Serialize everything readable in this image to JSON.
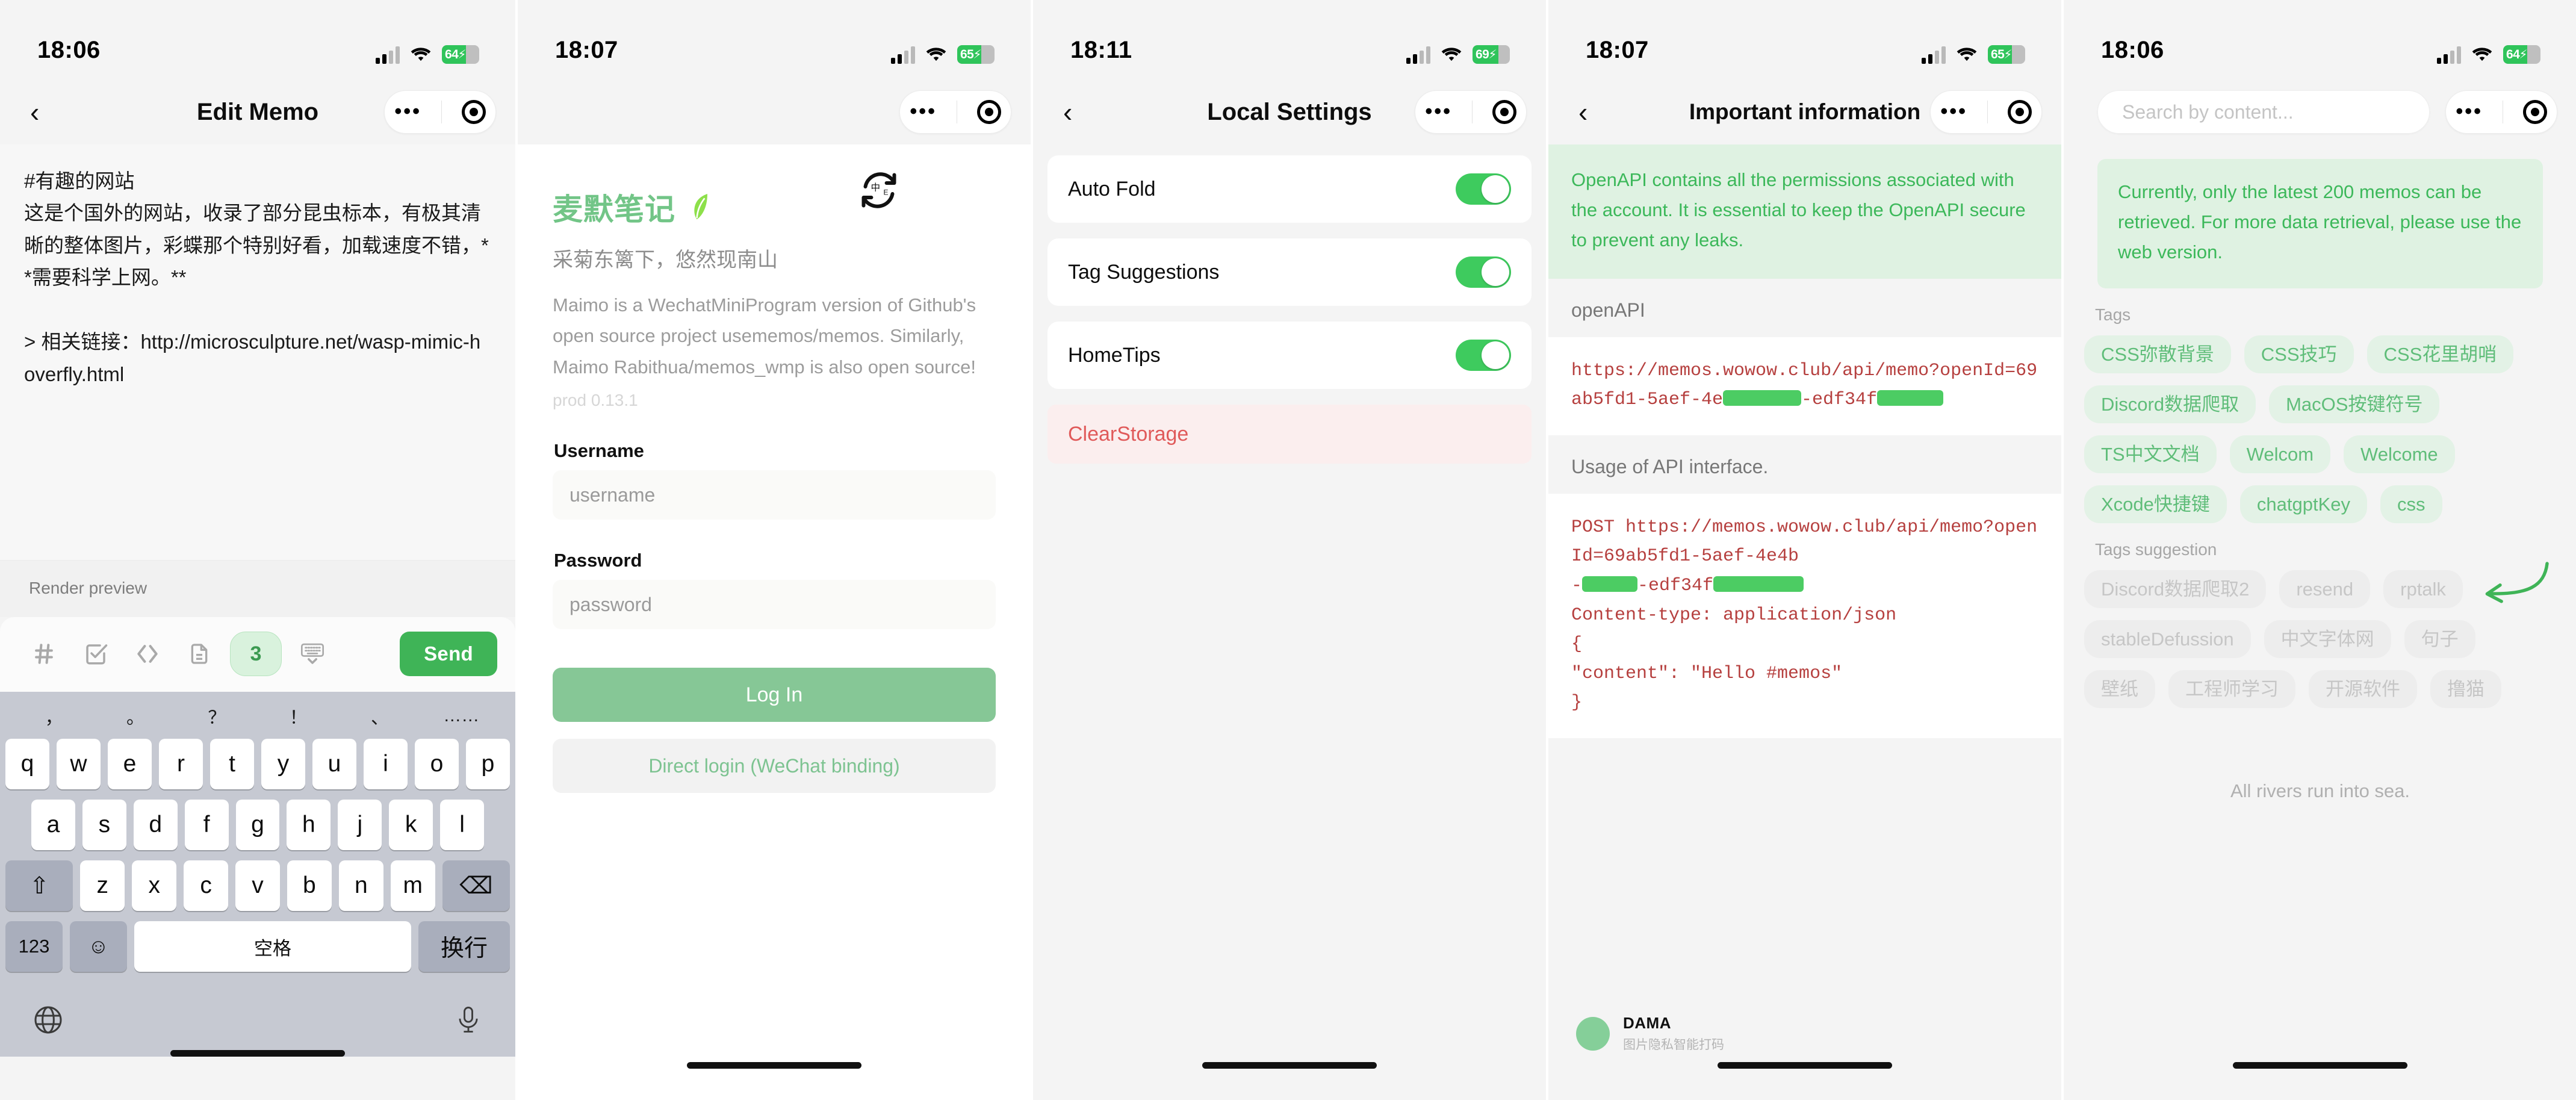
{
  "panels": {
    "memo_editor": {
      "status": {
        "time": "18:06",
        "battery": "64",
        "battery_pct_num": 64
      },
      "nav": {
        "back": "‹",
        "title": "Edit Memo",
        "more": "•••"
      },
      "memo_text": "#有趣的网站\n这是个国外的网站，收录了部分昆虫标本，有极其清晰的整体图片，彩蝶那个特别好看，加载速度不错，**需要科学上网。**\n\n> 相关链接：http://microsculpture.net/wasp-mimic-hoverfly.html",
      "render_preview_label": "Render preview",
      "toolbar": {
        "hash_icon": "hash-icon",
        "todo_icon": "checkbox-icon",
        "code_icon": "code-icon",
        "file_icon": "file-icon",
        "count": "3",
        "keyboard_icon": "keyboard-collapse-icon",
        "send_label": "Send"
      },
      "keyboard": {
        "suggestions": [
          "，",
          "。",
          "？",
          "！",
          "、",
          "……"
        ],
        "row1": [
          "q",
          "w",
          "e",
          "r",
          "t",
          "y",
          "u",
          "i",
          "o",
          "p"
        ],
        "row2": [
          "a",
          "s",
          "d",
          "f",
          "g",
          "h",
          "j",
          "k",
          "l"
        ],
        "row3_shift": "⇧",
        "row3": [
          "z",
          "x",
          "c",
          "v",
          "b",
          "n",
          "m"
        ],
        "row3_backspace": "⌫",
        "row4_num": "123",
        "row4_emoji": "☺",
        "row4_space": "空格",
        "row4_return": "换行",
        "globe_icon": "globe-icon",
        "mic_icon": "microphone-icon"
      }
    },
    "login": {
      "status": {
        "time": "18:07",
        "battery": "65",
        "battery_pct_num": 65
      },
      "nav": {
        "lang_toggle": "中/E",
        "more": "•••"
      },
      "brand_title": "麦默笔记",
      "brand_icon": "leaf-pen-icon",
      "tagline": "采菊东篱下，悠然现南山",
      "description": "Maimo is a WechatMiniProgram version of Github's open source project usememos/memos. Similarly, Maimo Rabithua/memos_wmp is also open source!",
      "version": "prod 0.13.1",
      "username_label": "Username",
      "username_placeholder": "username",
      "password_label": "Password",
      "password_placeholder": "password",
      "login_button": "Log In",
      "wechat_button": "Direct login (WeChat binding)"
    },
    "local_settings": {
      "status": {
        "time": "18:11",
        "battery": "69",
        "battery_pct_num": 69
      },
      "nav": {
        "back": "‹",
        "title": "Local Settings",
        "more": "•••"
      },
      "rows": [
        {
          "label": "Auto Fold",
          "toggle": "on"
        },
        {
          "label": "Tag Suggestions",
          "toggle": "on"
        },
        {
          "label": "HomeTips",
          "toggle": "on"
        }
      ],
      "clear_storage": "ClearStorage"
    },
    "important_info": {
      "status": {
        "time": "18:07",
        "battery": "65",
        "battery_pct_num": 65
      },
      "nav": {
        "back": "‹",
        "title": "Important information",
        "more": "•••"
      },
      "notice": "OpenAPI contains all the permissions associated with the account. It is essential to keep the OpenAPI secure to prevent any leaks.",
      "section1_label": "openAPI",
      "code1_prefix": "https://memos.wowow.club/api/memo?openId=69ab5fd1-5aef-4e",
      "code1_mid": "-edf34f",
      "section2_label": "Usage of API interface.",
      "code2_line1": "POST https://memos.wowow.club/api/memo?openId=69ab5fd1-5aef-4e4b",
      "code2_line2_prefix": "-",
      "code2_line2_mid": "-edf34f",
      "code2_line3": "Content-type: application/json",
      "code2_line4": "{",
      "code2_line5": "\"content\": \"Hello #memos\"",
      "code2_line6": "}",
      "footer": {
        "name": "DAMA",
        "subtitle": "图片隐私智能打码"
      }
    },
    "tags": {
      "status": {
        "time": "18:06",
        "battery": "64",
        "battery_pct_num": 64
      },
      "search_placeholder": "Search by content...",
      "nav": {
        "more": "•••"
      },
      "notice": "Currently, only the latest 200 memos can be retrieved. For more data retrieval, please use the web version.",
      "tags_label": "Tags",
      "tags": [
        "CSS弥散背景",
        "CSS技巧",
        "CSS花里胡哨",
        "Discord数据爬取",
        "MacOS按键符号",
        "TS中文文档",
        "Welcom",
        "Welcome",
        "Xcode快捷键",
        "chatgptKey",
        "css"
      ],
      "suggestion_label": "Tags suggestion",
      "suggestions": [
        "Discord数据爬取2",
        "resend",
        "rptalk",
        "stableDefussion",
        "中文字体网",
        "句子",
        "壁纸",
        "工程师学习",
        "开源软件",
        "撸猫"
      ],
      "footer_text": "All rivers run into sea.",
      "annotation_icon": "green-curved-arrow-icon"
    }
  },
  "colors": {
    "accent_green": "#3fb457",
    "light_green_bg": "#dff2e2",
    "chip_bg": "#e3f2e6",
    "chip_text": "#5fbd79",
    "danger": "#e05a5a",
    "code_red": "#b6403f",
    "redact": "#4ccc63"
  }
}
